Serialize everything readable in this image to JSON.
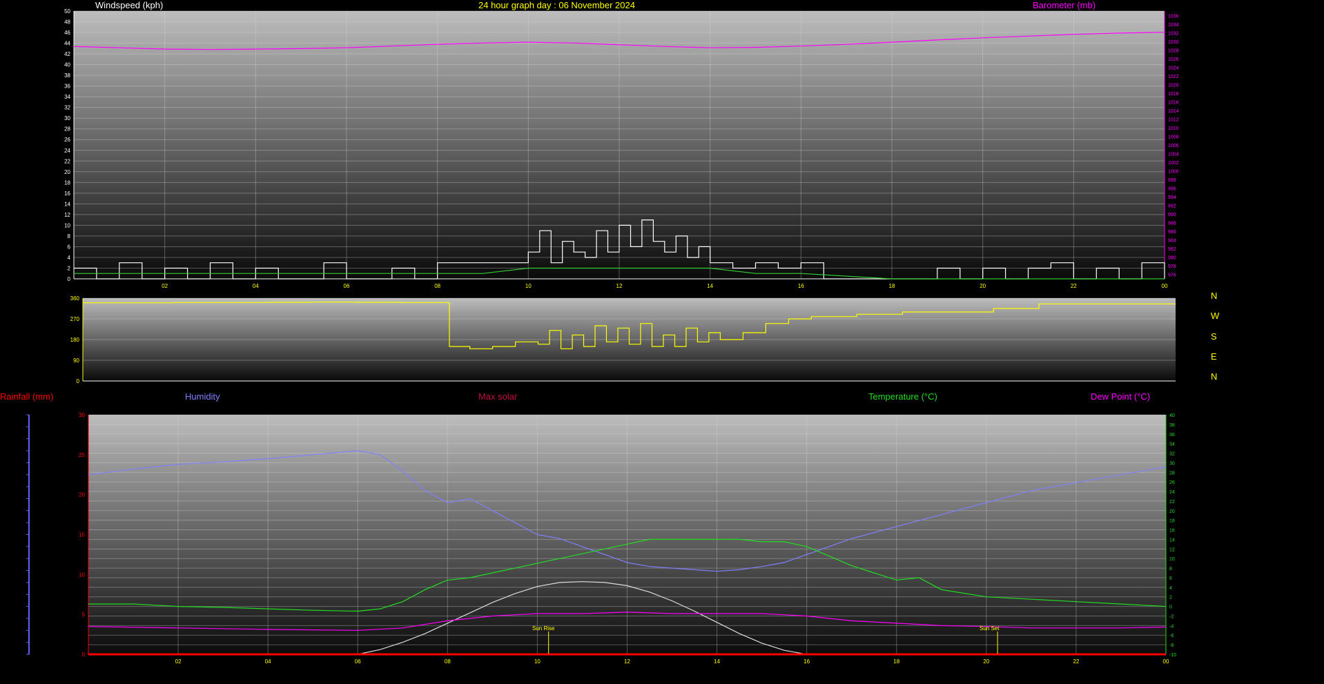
{
  "header": {
    "wind_label": "Windspeed (kph)",
    "title": "24 hour graph day : 06 November 2024",
    "baro_label": "Barometer (mb)"
  },
  "lower_header": {
    "rain_label": "Rainfall (mm)",
    "humidity_label": "Humidity",
    "solar_label": "Max solar",
    "temp_label": "Temperature (°C)",
    "dew_label": "Dew Point (°C)"
  },
  "compass": [
    "N",
    "W",
    "S",
    "E",
    "N"
  ],
  "annotations": {
    "sunrise": "Sun Rise",
    "sunset": "Sun Set"
  },
  "colors": {
    "wind": "#ffffff",
    "wind_avg": "#33cc33",
    "baro": "#ff00ff",
    "dir": "#ffff00",
    "humidity": "#8080ff",
    "temperature": "#22dd22",
    "dew": "#ff00ff",
    "solar": "#dddddd",
    "rain": "#ff0000"
  },
  "chart_data": [
    {
      "type": "line",
      "name": "wind_and_barometer",
      "x_ticks": [
        "02",
        "04",
        "06",
        "08",
        "10",
        "12",
        "14",
        "16",
        "18",
        "20",
        "22",
        "00"
      ],
      "y_left_ticks": [
        0,
        2,
        4,
        6,
        8,
        10,
        12,
        14,
        16,
        18,
        20,
        22,
        24,
        26,
        28,
        30,
        32,
        34,
        36,
        38,
        40,
        42,
        44,
        46,
        48,
        50
      ],
      "y_right_ticks": [
        976,
        978,
        980,
        982,
        984,
        986,
        988,
        990,
        992,
        994,
        996,
        998,
        1000,
        1002,
        1004,
        1006,
        1008,
        1010,
        1012,
        1014,
        1016,
        1018,
        1020,
        1022,
        1024,
        1026,
        1028,
        1030,
        1032,
        1034,
        1036
      ],
      "ylim_left": [
        0,
        50
      ],
      "ylim_right": [
        975,
        1037
      ],
      "xlim": [
        0,
        24
      ],
      "series": [
        {
          "name": "Barometer (mb)",
          "axis": "right",
          "x": [
            0,
            1,
            2,
            3,
            4,
            5,
            6,
            7,
            8,
            9,
            10,
            11,
            12,
            13,
            14,
            15,
            16,
            17,
            18,
            19,
            20,
            21,
            22,
            23,
            24
          ],
          "values": [
            1028.8,
            1028.5,
            1028.2,
            1028.1,
            1028.2,
            1028.3,
            1028.5,
            1028.9,
            1029.3,
            1029.6,
            1029.8,
            1029.6,
            1029.2,
            1028.8,
            1028.5,
            1028.6,
            1028.9,
            1029.3,
            1029.8,
            1030.3,
            1030.8,
            1031.2,
            1031.6,
            1031.9,
            1032.1
          ]
        },
        {
          "name": "Windspeed (kph)",
          "axis": "left",
          "x": [
            0,
            0.5,
            1,
            1.5,
            2,
            2.5,
            3,
            3.5,
            4,
            4.5,
            5,
            5.5,
            6,
            6.5,
            7,
            7.5,
            8,
            8.5,
            9,
            9.5,
            10,
            10.25,
            10.5,
            10.75,
            11,
            11.25,
            11.5,
            11.75,
            12,
            12.25,
            12.5,
            12.75,
            13,
            13.25,
            13.5,
            13.75,
            14,
            14.5,
            15,
            15.5,
            16,
            16.5,
            17,
            17.5,
            18,
            18.5,
            19,
            19.5,
            20,
            20.5,
            21,
            21.5,
            22,
            22.5,
            23,
            23.5,
            24
          ],
          "values": [
            2,
            0,
            3,
            0,
            2,
            0,
            3,
            0,
            2,
            0,
            0,
            3,
            0,
            0,
            2,
            0,
            3,
            3,
            3,
            3,
            5,
            9,
            3,
            7,
            5,
            4,
            9,
            5,
            10,
            6,
            11,
            7,
            5,
            8,
            4,
            6,
            3,
            2,
            3,
            2,
            3,
            0,
            0,
            0,
            0,
            0,
            2,
            0,
            2,
            0,
            2,
            3,
            0,
            2,
            0,
            3,
            0
          ]
        },
        {
          "name": "Avg wind (kph)",
          "axis": "left",
          "x": [
            0,
            2,
            4,
            6,
            8,
            9,
            10,
            11,
            12,
            13,
            14,
            15,
            16,
            18,
            20,
            22,
            24
          ],
          "values": [
            1,
            1,
            1,
            1,
            1,
            1,
            2,
            2,
            2,
            2,
            2,
            1,
            1,
            0,
            0,
            0,
            0
          ]
        }
      ]
    },
    {
      "type": "line",
      "name": "wind_direction",
      "x_ticks": [],
      "y_ticks": [
        0,
        90,
        180,
        270,
        360
      ],
      "ylim": [
        0,
        360
      ],
      "xlim": [
        0,
        24
      ],
      "series": [
        {
          "name": "Direction",
          "x": [
            0,
            1,
            2,
            3,
            4,
            5,
            6,
            7,
            8,
            8.05,
            8.5,
            9,
            9.5,
            10,
            10.25,
            10.5,
            10.75,
            11,
            11.25,
            11.5,
            11.75,
            12,
            12.25,
            12.5,
            12.75,
            13,
            13.25,
            13.5,
            13.75,
            14,
            14.5,
            15,
            15.5,
            16,
            17,
            18,
            19,
            20,
            21,
            22,
            23,
            24
          ],
          "values": [
            340,
            340,
            341,
            341,
            342,
            343,
            342,
            341,
            340,
            150,
            140,
            150,
            170,
            160,
            220,
            140,
            200,
            150,
            240,
            170,
            230,
            160,
            250,
            150,
            200,
            150,
            230,
            170,
            210,
            180,
            210,
            250,
            270,
            280,
            290,
            300,
            300,
            315,
            335,
            335,
            335,
            335
          ]
        }
      ]
    },
    {
      "type": "line",
      "name": "temperature_humidity_dewpoint_solar_rain",
      "x_ticks": [
        "02",
        "04",
        "06",
        "08",
        "10",
        "12",
        "14",
        "16",
        "18",
        "20",
        "22",
        "00"
      ],
      "y_left_ticks": [
        0,
        5,
        10,
        15,
        20,
        25,
        30
      ],
      "y_right_ticks": [
        -10,
        -8,
        -6,
        -4,
        -2,
        0,
        2,
        4,
        6,
        8,
        10,
        12,
        14,
        16,
        18,
        20,
        22,
        24,
        26,
        28,
        30,
        32,
        34,
        36,
        38,
        40
      ],
      "ylim_left": [
        0,
        30
      ],
      "ylim_right": [
        -10,
        40
      ],
      "xlim": [
        0,
        24
      ],
      "series": [
        {
          "name": "Humidity",
          "axis": "left",
          "x": [
            0,
            1,
            2,
            3,
            4,
            5,
            6,
            6.5,
            7,
            7.5,
            8,
            8.5,
            9,
            9.5,
            10,
            10.5,
            11,
            11.5,
            12,
            12.5,
            13,
            13.5,
            14,
            14.5,
            15,
            15.5,
            16,
            17,
            18,
            19,
            20,
            21,
            22,
            23,
            24
          ],
          "values": [
            22.5,
            23.2,
            23.8,
            24.1,
            24.5,
            25.0,
            25.5,
            25.0,
            23.0,
            20.5,
            19.0,
            19.5,
            18.0,
            16.5,
            15.0,
            14.5,
            13.5,
            12.5,
            11.5,
            11.0,
            10.8,
            10.6,
            10.4,
            10.6,
            11.0,
            11.5,
            12.5,
            14.5,
            16.0,
            17.5,
            19.0,
            20.5,
            21.5,
            22.5,
            23.5
          ]
        },
        {
          "name": "Temperature (°C)",
          "axis": "right",
          "x": [
            0,
            1,
            2,
            3,
            4,
            5,
            6,
            6.5,
            7,
            7.5,
            8,
            8.5,
            9,
            9.5,
            10,
            10.5,
            11,
            11.5,
            12,
            12.5,
            13,
            13.5,
            14,
            14.5,
            15,
            15.5,
            16,
            16.5,
            17,
            17.5,
            18,
            18.5,
            19,
            20,
            21,
            22,
            23,
            24
          ],
          "values": [
            0.5,
            0.5,
            0,
            -0.2,
            -0.5,
            -0.8,
            -1.0,
            -0.5,
            1.0,
            3.5,
            5.5,
            6.0,
            7.0,
            8.0,
            9.0,
            10.0,
            11.0,
            12.0,
            13.0,
            14.0,
            14.0,
            14.0,
            14.0,
            14.0,
            13.5,
            13.5,
            12.5,
            10.5,
            8.5,
            7.0,
            5.5,
            6.0,
            3.5,
            2.0,
            1.5,
            1.0,
            0.5,
            0
          ]
        },
        {
          "name": "Dew Point (°C)",
          "axis": "right",
          "x": [
            0,
            2,
            4,
            6,
            7,
            8,
            9,
            10,
            11,
            12,
            13,
            14,
            15,
            16,
            17,
            18,
            19,
            20,
            21,
            22,
            23,
            24
          ],
          "values": [
            -4.2,
            -4.5,
            -4.8,
            -5.0,
            -4.5,
            -3.0,
            -2.0,
            -1.5,
            -1.5,
            -1.2,
            -1.5,
            -1.5,
            -1.5,
            -2.0,
            -3.0,
            -3.5,
            -4.0,
            -4.2,
            -4.5,
            -4.5,
            -4.5,
            -4.3
          ]
        },
        {
          "name": "Max solar",
          "axis": "left",
          "x": [
            6,
            6.5,
            7,
            7.5,
            8,
            8.5,
            9,
            9.5,
            10,
            10.5,
            11,
            11.5,
            12,
            12.5,
            13,
            13.5,
            14,
            14.5,
            15,
            15.5,
            16
          ],
          "values": [
            0,
            0.6,
            1.5,
            2.6,
            3.9,
            5.2,
            6.5,
            7.6,
            8.5,
            9.0,
            9.1,
            9.0,
            8.6,
            7.8,
            6.7,
            5.4,
            4.0,
            2.6,
            1.4,
            0.5,
            0
          ]
        },
        {
          "name": "Rainfall (mm)",
          "axis": "left",
          "x": [
            0,
            24
          ],
          "values": [
            0,
            0
          ]
        }
      ]
    }
  ]
}
